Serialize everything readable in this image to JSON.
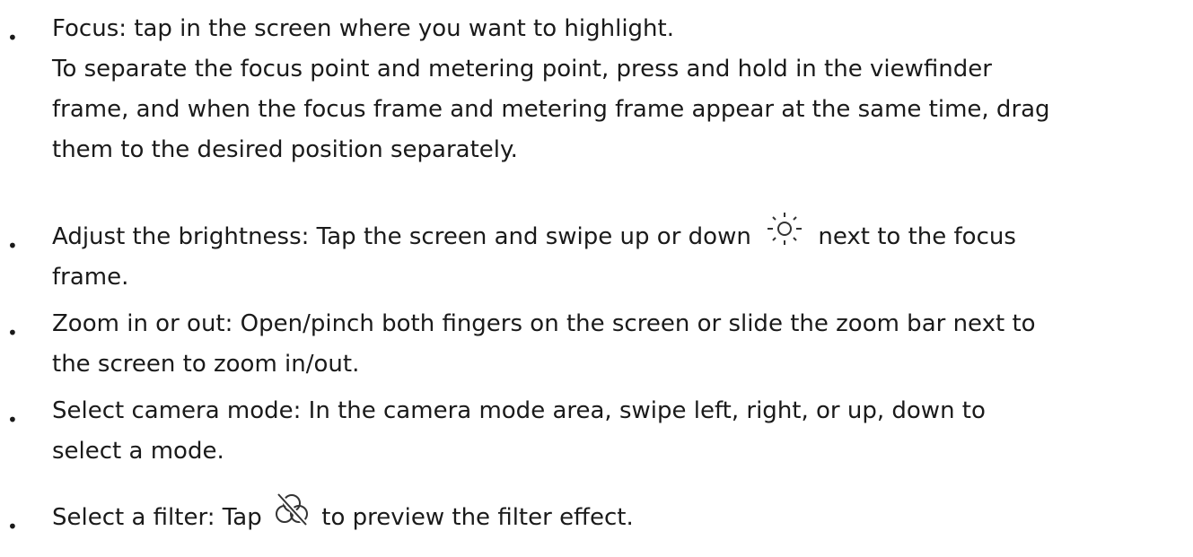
{
  "items": [
    {
      "lines": [
        "Focus: tap in the screen where you want to highlight.",
        "To separate the focus point and metering point, press and hold in the viewfinder",
        "frame, and when the focus frame and metering frame appear at the same time, drag",
        "them to the desired position separately."
      ]
    },
    {
      "line1_before": "Adjust the brightness: Tap the screen and swipe up or down",
      "line1_icon": "sun-brightness-icon",
      "line1_after": "next to the focus",
      "line2": "frame."
    },
    {
      "lines": [
        "Zoom in or out: Open/pinch both fingers on the screen or slide the zoom bar next to",
        "the screen to zoom in/out."
      ]
    },
    {
      "lines": [
        "Select camera mode: In the camera mode area, swipe left, right, or up, down to",
        "select a mode."
      ]
    },
    {
      "line1_before": "Select a filter: Tap",
      "line1_icon": "filter-off-icon",
      "line1_after": "to preview the filter effect."
    }
  ],
  "bullet_char": "•"
}
